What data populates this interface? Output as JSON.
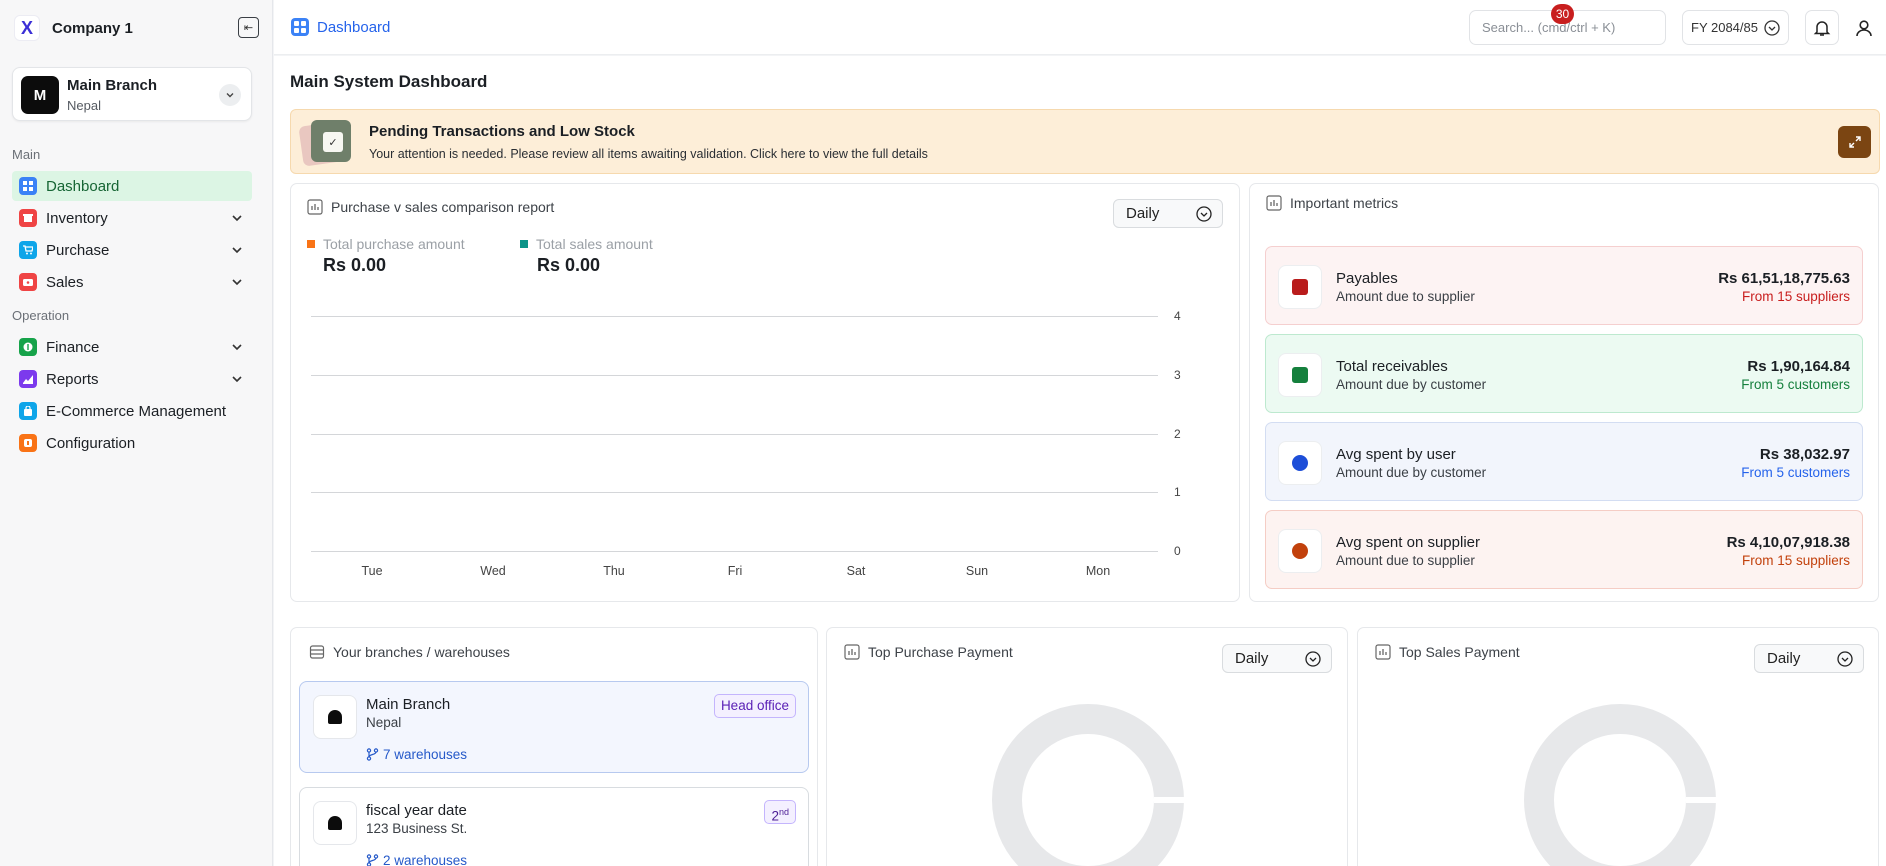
{
  "brand": {
    "logo": "X",
    "name": "Company 1"
  },
  "branch_selector": {
    "avatar": "M",
    "name": "Main Branch",
    "location": "Nepal"
  },
  "nav": {
    "main_label": "Main",
    "operation_label": "Operation",
    "items": [
      {
        "label": "Dashboard",
        "icon": "grid-icon",
        "color": "#3b82f6"
      },
      {
        "label": "Inventory",
        "icon": "box-icon",
        "color": "#ef4444"
      },
      {
        "label": "Purchase",
        "icon": "cart-icon",
        "color": "#0ea5e9"
      },
      {
        "label": "Sales",
        "icon": "tag-icon",
        "color": "#ef4444"
      },
      {
        "label": "Finance",
        "icon": "coin-icon",
        "color": "#16a34a"
      },
      {
        "label": "Reports",
        "icon": "chart-icon",
        "color": "#7c3aed"
      },
      {
        "label": "E-Commerce Management",
        "icon": "store-icon",
        "color": "#0ea5e9"
      },
      {
        "label": "Configuration",
        "icon": "gear-icon",
        "color": "#f97316"
      }
    ]
  },
  "topbar": {
    "breadcrumb": "Dashboard",
    "search_placeholder": "Search... (cmd/ctrl + K)",
    "fiscal_year": "FY 2084/85",
    "notification_count": "30"
  },
  "page": {
    "title": "Main System Dashboard"
  },
  "alert": {
    "title": "Pending Transactions and Low Stock",
    "message": "Your attention is needed. Please review all items awaiting validation. Click here to view the full details"
  },
  "comparison": {
    "title": "Purchase v sales comparison report",
    "period": "Daily",
    "purchase_label": "Total purchase amount",
    "purchase_value": "Rs 0.00",
    "sales_label": "Total sales amount",
    "sales_value": "Rs 0.00",
    "purchase_color": "#f97316",
    "sales_color": "#0d9488"
  },
  "chart_data": {
    "type": "line",
    "categories": [
      "Tue",
      "Wed",
      "Thu",
      "Fri",
      "Sat",
      "Sun",
      "Mon"
    ],
    "y_ticks": [
      "4",
      "3",
      "2",
      "1",
      "0"
    ],
    "ylim": [
      0,
      4
    ],
    "series": [
      {
        "name": "Total purchase amount",
        "values": [
          0,
          0,
          0,
          0,
          0,
          0,
          0
        ]
      },
      {
        "name": "Total sales amount",
        "values": [
          0,
          0,
          0,
          0,
          0,
          0,
          0
        ]
      }
    ],
    "grid": true,
    "y_axis_side": "right"
  },
  "metrics": {
    "title": "Important metrics",
    "items": [
      {
        "title": "Payables",
        "subtitle": "Amount due to supplier",
        "value": "Rs 61,51,18,775.63",
        "note": "From 15 suppliers",
        "bg": "#fdf3f3",
        "border": "#f5cfcf",
        "accent": "#c81e1e",
        "icon_color": "#b91c1c"
      },
      {
        "title": "Total receivables",
        "subtitle": "Amount due by customer",
        "value": "Rs 1,90,164.84",
        "note": "From 5 customers",
        "bg": "#ecfaf2",
        "border": "#bde9cf",
        "accent": "#15803d",
        "icon_color": "#15803d"
      },
      {
        "title": "Avg spent by user",
        "subtitle": "Amount due by customer",
        "value": "Rs 38,032.97",
        "note": "From 5 customers",
        "bg": "#f2f5fc",
        "border": "#d3ddf2",
        "accent": "#2563eb",
        "icon_color": "#1d4ed8"
      },
      {
        "title": "Avg spent on supplier",
        "subtitle": "Amount due to supplier",
        "value": "Rs 4,10,07,918.38",
        "note": "From 15 suppliers",
        "bg": "#fdf3f1",
        "border": "#f5cdc5",
        "accent": "#c2410c",
        "icon_color": "#c2410c"
      }
    ]
  },
  "branches": {
    "title": "Your branches / warehouses",
    "items": [
      {
        "name": "Main Branch",
        "location": "Nepal",
        "warehouses": "7 warehouses",
        "badge": "Head office"
      },
      {
        "name": "fiscal year date",
        "location": "123 Business St.",
        "warehouses": "2 warehouses",
        "badge_num": "2",
        "badge_sup": "nd"
      }
    ]
  },
  "top_purchase": {
    "title": "Top Purchase Payment",
    "period": "Daily"
  },
  "top_sales": {
    "title": "Top Sales Payment",
    "period": "Daily"
  }
}
